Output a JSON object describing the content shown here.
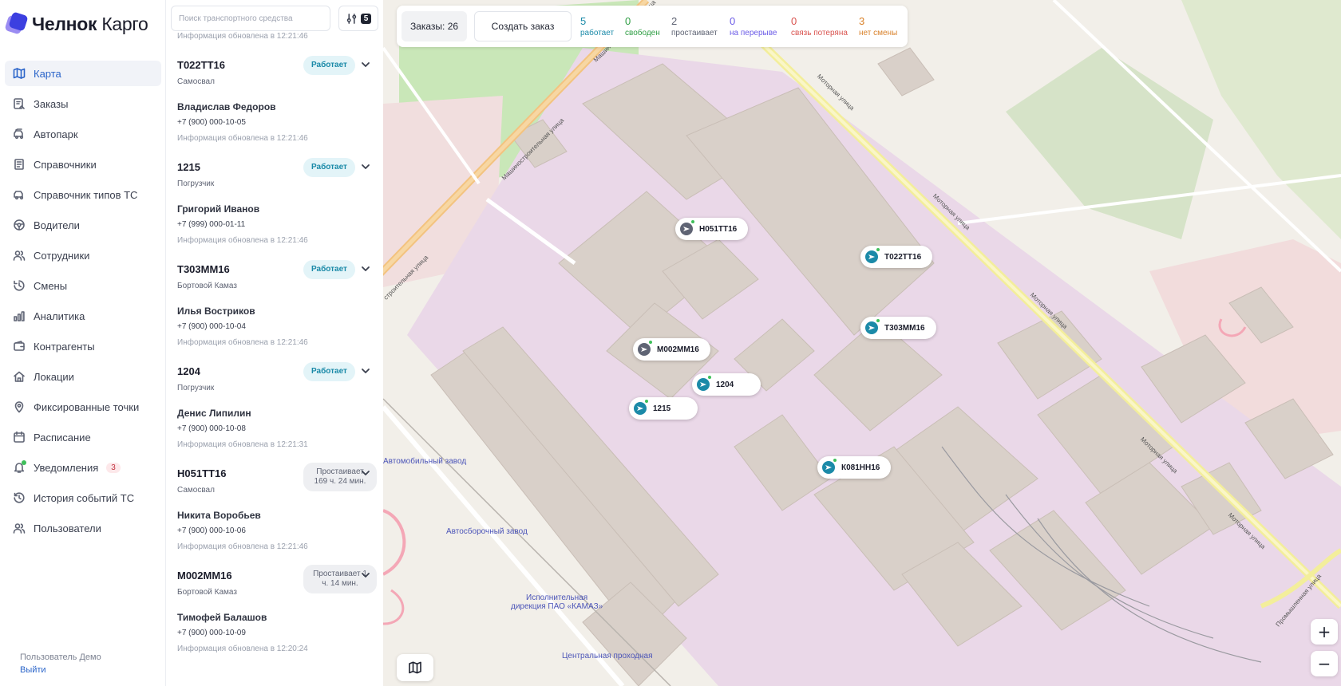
{
  "app": {
    "brand_bold": "Челнок",
    "brand_light": "Карго"
  },
  "nav": {
    "items": [
      {
        "label": "Карта",
        "icon": "map-icon",
        "active": true
      },
      {
        "label": "Заказы",
        "icon": "orders-icon"
      },
      {
        "label": "Автопарк",
        "icon": "fleet-icon"
      },
      {
        "label": "Справочники",
        "icon": "book-icon"
      },
      {
        "label": "Справочник типов ТС",
        "icon": "vehicle-types-icon"
      },
      {
        "label": "Водители",
        "icon": "steering-wheel-icon"
      },
      {
        "label": "Сотрудники",
        "icon": "employees-icon"
      },
      {
        "label": "Смены",
        "icon": "clock-icon"
      },
      {
        "label": "Аналитика",
        "icon": "bar-chart-icon"
      },
      {
        "label": "Контрагенты",
        "icon": "wallet-icon"
      },
      {
        "label": "Локации",
        "icon": "home-icon"
      },
      {
        "label": "Фиксированные точки",
        "icon": "pin-icon"
      },
      {
        "label": "Расписание",
        "icon": "calendar-icon"
      },
      {
        "label": "Уведомления",
        "icon": "bell-icon",
        "badge": "3"
      },
      {
        "label": "История событий ТС",
        "icon": "history-icon"
      },
      {
        "label": "Пользователи",
        "icon": "users-icon"
      }
    ]
  },
  "user": {
    "name": "Пользователь Демо",
    "logout": "Выйти"
  },
  "list": {
    "search_placeholder": "Поиск транспортного средства",
    "filter_count": "5",
    "first_updated": "Информация обновлена в 12:21:46",
    "vehicles": [
      {
        "plate": "Т022ТТ16",
        "type": "Самосвал",
        "status": "Работает",
        "status_kind": "working",
        "driver": "Владислав Федоров",
        "phone": "+7 (900) 000-10-05",
        "updated": "Информация обновлена в 12:21:46"
      },
      {
        "plate": "1215",
        "type": "Погрузчик",
        "status": "Работает",
        "status_kind": "working",
        "driver": "Григорий Иванов",
        "phone": "+7 (999) 000-01-11",
        "updated": "Информация обновлена в 12:21:46"
      },
      {
        "plate": "Т303ММ16",
        "type": "Бортовой Камаз",
        "status": "Работает",
        "status_kind": "working",
        "driver": "Илья Востриков",
        "phone": "+7 (900) 000-10-04",
        "updated": "Информация обновлена в 12:21:46"
      },
      {
        "plate": "1204",
        "type": "Погрузчик",
        "status": "Работает",
        "status_kind": "working",
        "driver": "Денис Липилин",
        "phone": "+7 (900) 000-10-08",
        "updated": "Информация обновлена в 12:21:31"
      },
      {
        "plate": "Н051ТТ16",
        "type": "Самосвал",
        "status": "Простаивает 169 ч. 24 мин.",
        "status_kind": "idle",
        "driver": "Никита Воробьев",
        "phone": "+7 (900) 000-10-06",
        "updated": "Информация обновлена в 12:21:46"
      },
      {
        "plate": "М002ММ16",
        "type": "Бортовой Камаз",
        "status": "Простаивает 1 ч. 14 мин.",
        "status_kind": "idle",
        "driver": "Тимофей Балашов",
        "phone": "+7 (900) 000-10-09",
        "updated": "Информация обновлена в 12:20:24"
      }
    ]
  },
  "topbar": {
    "orders_label": "Заказы: 26",
    "create_order": "Создать заказ",
    "stats": [
      {
        "value": "5",
        "label": "работает",
        "color": "#1b8aa8"
      },
      {
        "value": "0",
        "label": "свободен",
        "color": "#2f9e44"
      },
      {
        "value": "2",
        "label": "простаивает",
        "color": "#5f6474"
      },
      {
        "value": "0",
        "label": "на перерыве",
        "color": "#6c5ce7"
      },
      {
        "value": "0",
        "label": "связь потеряна",
        "color": "#d9534f"
      },
      {
        "value": "3",
        "label": "нет смены",
        "color": "#d9822b"
      }
    ]
  },
  "map": {
    "labels": {
      "auto_plant": "Автомобильный завод",
      "assembly_plant": "Автосборочный завод",
      "executive_1": "Исполнительная",
      "executive_2": "дирекция ПАО «КАМАЗ»",
      "central_gate": "Центральная проходная"
    },
    "streets": {
      "mash_top": "Машиностроительная улица",
      "mash_mid": "Машиностроительная улица",
      "mash_left": "строительная улица",
      "motor_top": "Моторная улица",
      "motor_mid": "Моторная улица",
      "motor_r1": "Моторная улица",
      "motor_r2": "Моторная улица",
      "motor_r3": "Моторная улица",
      "motor_bottom": "Моторная улица",
      "industrial": "Промышленная улица"
    },
    "markers": [
      {
        "label": "Н051ТТ16",
        "kind": "idle"
      },
      {
        "label": "Т022ТТ16",
        "kind": "working"
      },
      {
        "label": "Т303ММ16",
        "kind": "working"
      },
      {
        "label": "М002ММ16",
        "kind": "idle"
      },
      {
        "label": "1204",
        "kind": "working"
      },
      {
        "label": "1215",
        "kind": "working"
      },
      {
        "label": "К081НН16",
        "kind": "working"
      }
    ],
    "zoom_in": "+",
    "zoom_out": "−"
  },
  "colors": {
    "accent": "#2a64c9",
    "working": "#1b8aa8",
    "idle": "#5f6474",
    "online_dot": "#3fbf5a"
  }
}
